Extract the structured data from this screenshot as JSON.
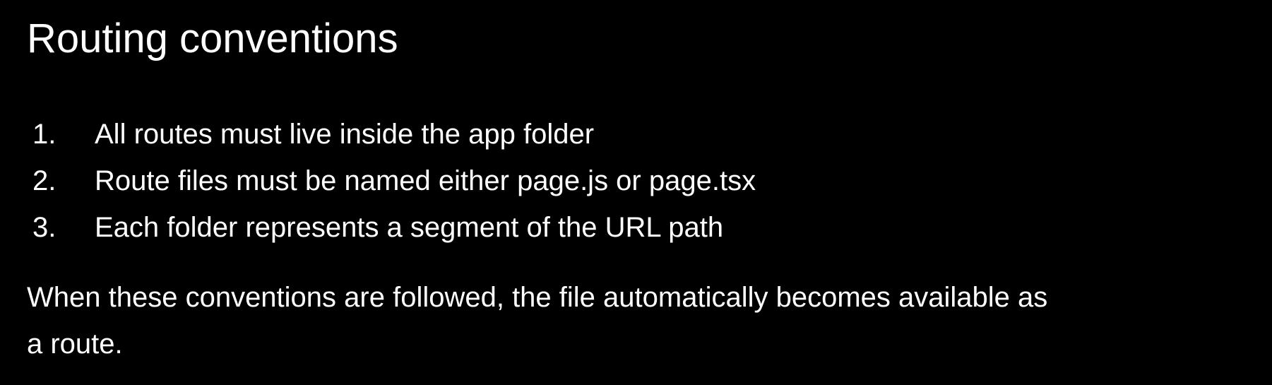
{
  "slide": {
    "title": "Routing conventions",
    "list": [
      {
        "number": "1.",
        "text": "All routes must live inside the app folder"
      },
      {
        "number": "2.",
        "text": "Route files must be named either page.js or page.tsx"
      },
      {
        "number": "3.",
        "text": "Each folder represents a segment of the URL path"
      }
    ],
    "paragraph_line1": "When these conventions are followed, the file automatically becomes available as",
    "paragraph_line2": "a route."
  },
  "colors": {
    "background": "#000000",
    "text": "#ffffff"
  }
}
